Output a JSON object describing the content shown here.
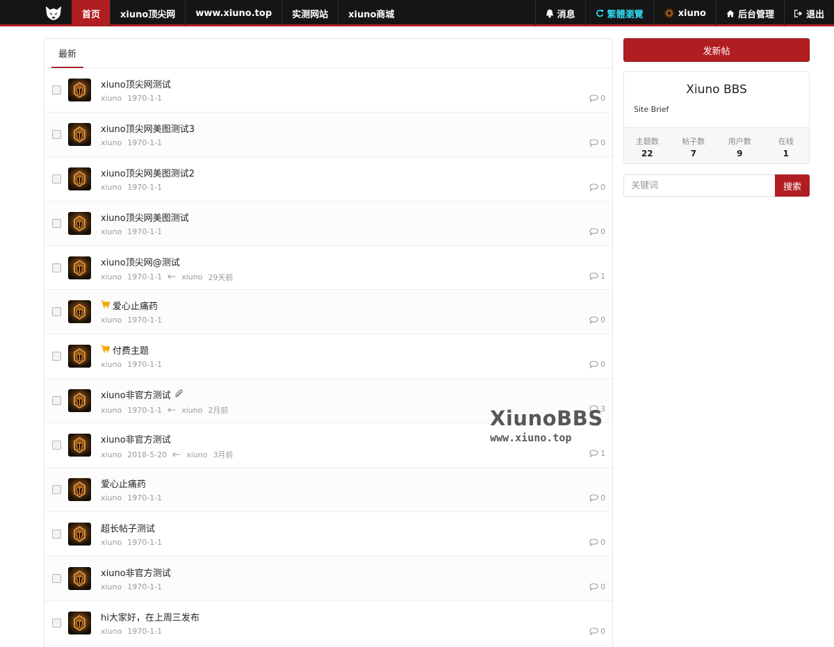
{
  "navbar": {
    "logo": "bbs-logo-icon",
    "left_items": [
      {
        "label": "首页",
        "active": true
      },
      {
        "label": "xiuno顶尖网",
        "active": false
      },
      {
        "label": "www.xiuno.top",
        "active": false
      },
      {
        "label": "实测网站",
        "active": false
      },
      {
        "label": "xiuno商城",
        "active": false
      }
    ],
    "right_items": [
      {
        "label": "消息",
        "icon": "bell-icon"
      },
      {
        "label": "繁體瀏覽",
        "icon": "refresh-icon"
      },
      {
        "label": "xiuno",
        "icon": "user-avatar-icon"
      },
      {
        "label": "后台管理",
        "icon": "home-icon"
      },
      {
        "label": "退出",
        "icon": "logout-icon"
      }
    ]
  },
  "main": {
    "tab_label": "最新",
    "threads": [
      {
        "subject": "xiuno顶尖网测试",
        "author": "xiuno",
        "date": "1970-1-1",
        "last_user": "",
        "last_time": "",
        "replies": "0",
        "paid": false,
        "attachment": false
      },
      {
        "subject": "xiuno顶尖网美图测试3",
        "author": "xiuno",
        "date": "1970-1-1",
        "last_user": "",
        "last_time": "",
        "replies": "0",
        "paid": false,
        "attachment": false
      },
      {
        "subject": "xiuno顶尖网美图测试2",
        "author": "xiuno",
        "date": "1970-1-1",
        "last_user": "",
        "last_time": "",
        "replies": "0",
        "paid": false,
        "attachment": false
      },
      {
        "subject": "xiuno顶尖网美图测试",
        "author": "xiuno",
        "date": "1970-1-1",
        "last_user": "",
        "last_time": "",
        "replies": "0",
        "paid": false,
        "attachment": false
      },
      {
        "subject": "xiuno顶尖网@测试",
        "author": "xiuno",
        "date": "1970-1-1",
        "last_user": "xiuno",
        "last_time": "29天前",
        "replies": "1",
        "paid": false,
        "attachment": false
      },
      {
        "subject": "爱心止痛药",
        "author": "xiuno",
        "date": "1970-1-1",
        "last_user": "",
        "last_time": "",
        "replies": "0",
        "paid": true,
        "attachment": false
      },
      {
        "subject": "付费主题",
        "author": "xiuno",
        "date": "1970-1-1",
        "last_user": "",
        "last_time": "",
        "replies": "0",
        "paid": true,
        "attachment": false
      },
      {
        "subject": "xiuno非官方测试",
        "author": "xiuno",
        "date": "1970-1-1",
        "last_user": "xiuno",
        "last_time": "2月前",
        "replies": "3",
        "paid": false,
        "attachment": true
      },
      {
        "subject": "xiuno非官方测试",
        "author": "xiuno",
        "date": "2018-5-20",
        "last_user": "xiuno",
        "last_time": "3月前",
        "replies": "1",
        "paid": false,
        "attachment": false
      },
      {
        "subject": "爱心止痛药",
        "author": "xiuno",
        "date": "1970-1-1",
        "last_user": "",
        "last_time": "",
        "replies": "0",
        "paid": false,
        "attachment": false
      },
      {
        "subject": "超长帖子测试",
        "author": "xiuno",
        "date": "1970-1-1",
        "last_user": "",
        "last_time": "",
        "replies": "0",
        "paid": false,
        "attachment": false
      },
      {
        "subject": "xiuno非官方测试",
        "author": "xiuno",
        "date": "1970-1-1",
        "last_user": "",
        "last_time": "",
        "replies": "0",
        "paid": false,
        "attachment": false
      },
      {
        "subject": "hi大家好，在上周三发布",
        "author": "xiuno",
        "date": "1970-1-1",
        "last_user": "",
        "last_time": "",
        "replies": "0",
        "paid": false,
        "attachment": false
      }
    ]
  },
  "sidebar": {
    "new_thread_label": "发新帖",
    "site_title": "Xiuno BBS",
    "site_brief": "Site Brief",
    "stats": [
      {
        "label": "主题数",
        "value": "22"
      },
      {
        "label": "帖子数",
        "value": "7"
      },
      {
        "label": "用户数",
        "value": "9"
      },
      {
        "label": "在线",
        "value": "1"
      }
    ],
    "search_placeholder": "关键词",
    "search_button": "搜索"
  },
  "watermark": {
    "title": "XiunoBBS",
    "url": "www.xiuno.top"
  },
  "colors": {
    "accent": "#b11e22",
    "navbar_bg": "#151515",
    "highlight_cyan": "#2fd0e8",
    "paid_icon": "#f0a800"
  }
}
